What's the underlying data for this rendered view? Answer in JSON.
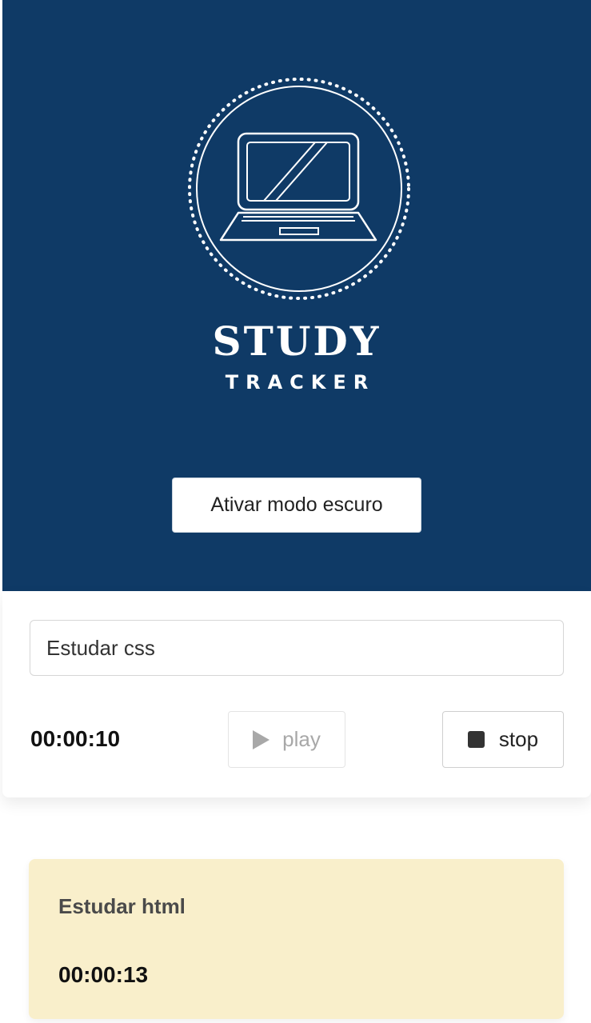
{
  "header": {
    "logo_icon": "laptop-icon",
    "title": "STUDY",
    "subtitle": "TRACKER",
    "dark_mode_button_label": "Ativar modo escuro",
    "background_color": "#0f3a66"
  },
  "form": {
    "task_input_value": "Estudar css",
    "current_timer": "00:00:10",
    "play_label": "play",
    "play_icon": "play-icon",
    "stop_label": "stop",
    "stop_icon": "stop-icon"
  },
  "tasks": [
    {
      "name": "Estudar html",
      "time": "00:00:13",
      "card_color": "#f9efcb"
    }
  ]
}
